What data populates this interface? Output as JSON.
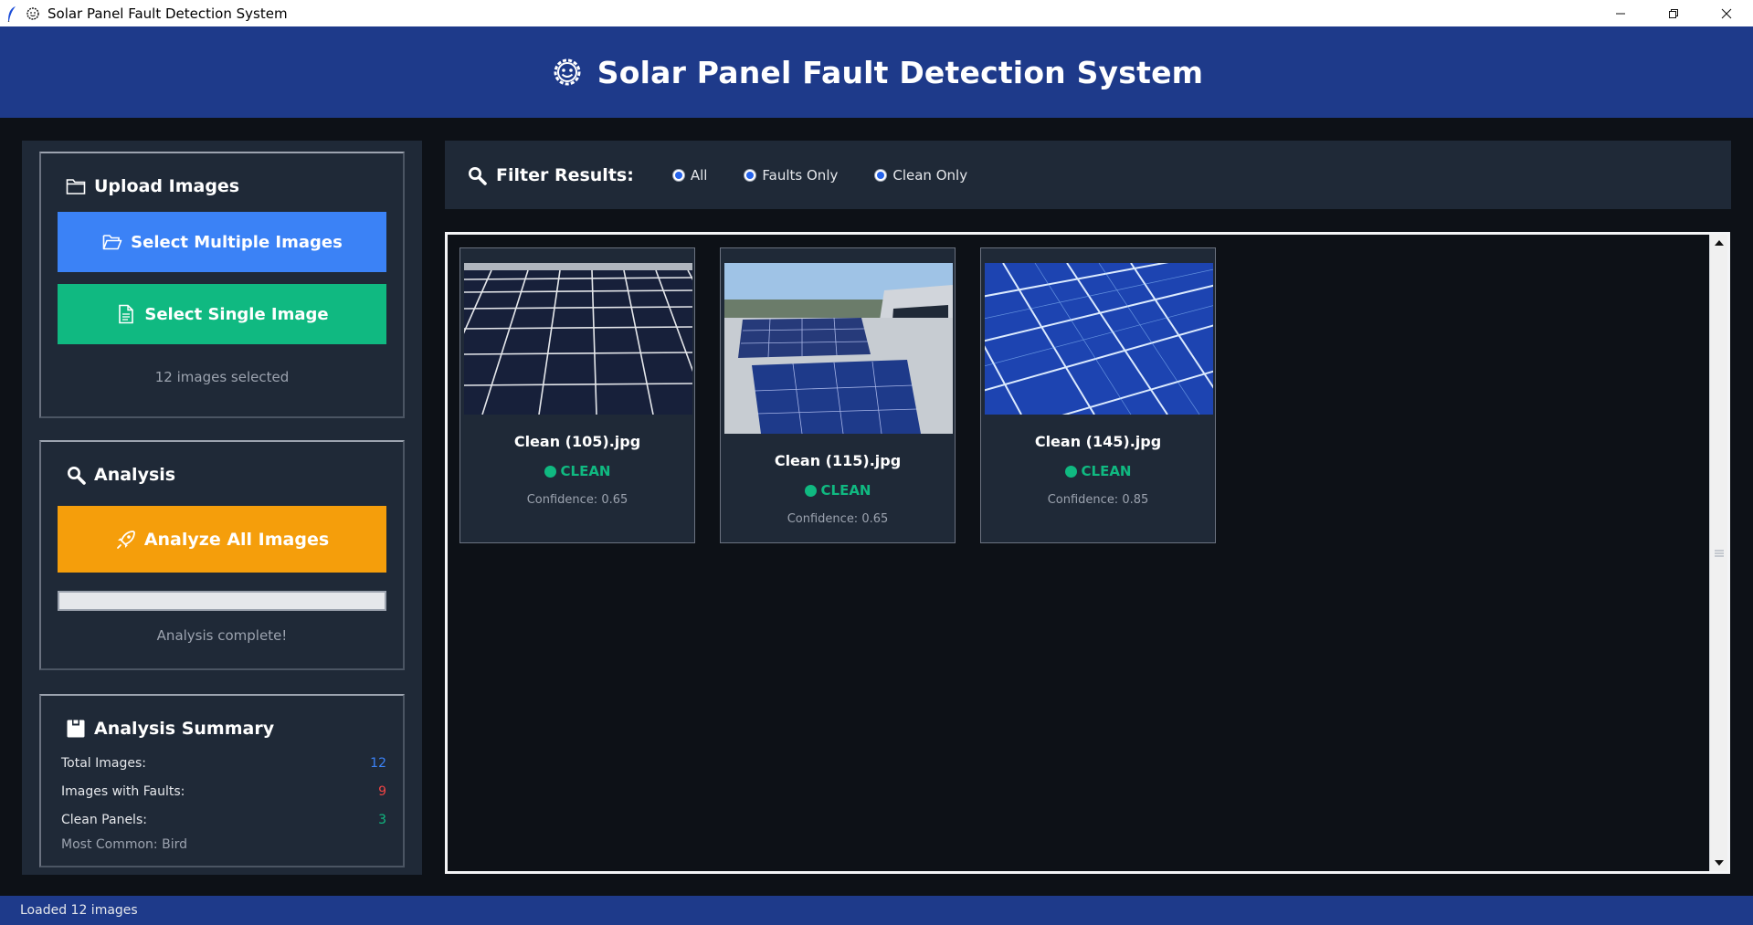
{
  "window": {
    "title": "Solar Panel Fault Detection System",
    "icons": {
      "app": "feather-icon",
      "logo": "smiley-gear-icon"
    }
  },
  "header": {
    "title": "Solar Panel Fault Detection System",
    "icon": "smiley-gear-icon"
  },
  "upload": {
    "title": "Upload Images",
    "multi_button": "Select Multiple Images",
    "single_button": "Select Single Image",
    "selected_text": "12 images selected"
  },
  "analysis": {
    "title": "Analysis",
    "analyze_button": "Analyze All Images",
    "progress": 1.0,
    "status_text": "Analysis complete!"
  },
  "summary": {
    "title": "Analysis Summary",
    "rows": [
      {
        "label": "Total Images:",
        "value": "12",
        "color": "#3b82f6"
      },
      {
        "label": "Images with Faults:",
        "value": "9",
        "color": "#ef4444"
      },
      {
        "label": "Clean Panels:",
        "value": "3",
        "color": "#10b981"
      },
      {
        "label": "Most Common: Bird",
        "value": "",
        "color": "#9ca3af"
      }
    ]
  },
  "filter": {
    "label": "Filter Results:",
    "options": [
      "All",
      "Faults Only",
      "Clean Only"
    ],
    "selected": "Clean Only"
  },
  "results": [
    {
      "name": "Clean (105).jpg",
      "status": "CLEAN",
      "confidence": "Confidence: 0.65"
    },
    {
      "name": "Clean (115).jpg",
      "status": "CLEAN",
      "confidence": "Confidence: 0.65"
    },
    {
      "name": "Clean (145).jpg",
      "status": "CLEAN",
      "confidence": "Confidence: 0.85"
    }
  ],
  "statusbar": {
    "text": "Loaded 12 images"
  },
  "colors": {
    "header_bg": "#1e3a8a",
    "panel_bg": "#1f2937",
    "app_bg": "#0d1117",
    "blue": "#3b82f6",
    "green": "#10b981",
    "orange": "#f59e0b",
    "red": "#ef4444"
  }
}
